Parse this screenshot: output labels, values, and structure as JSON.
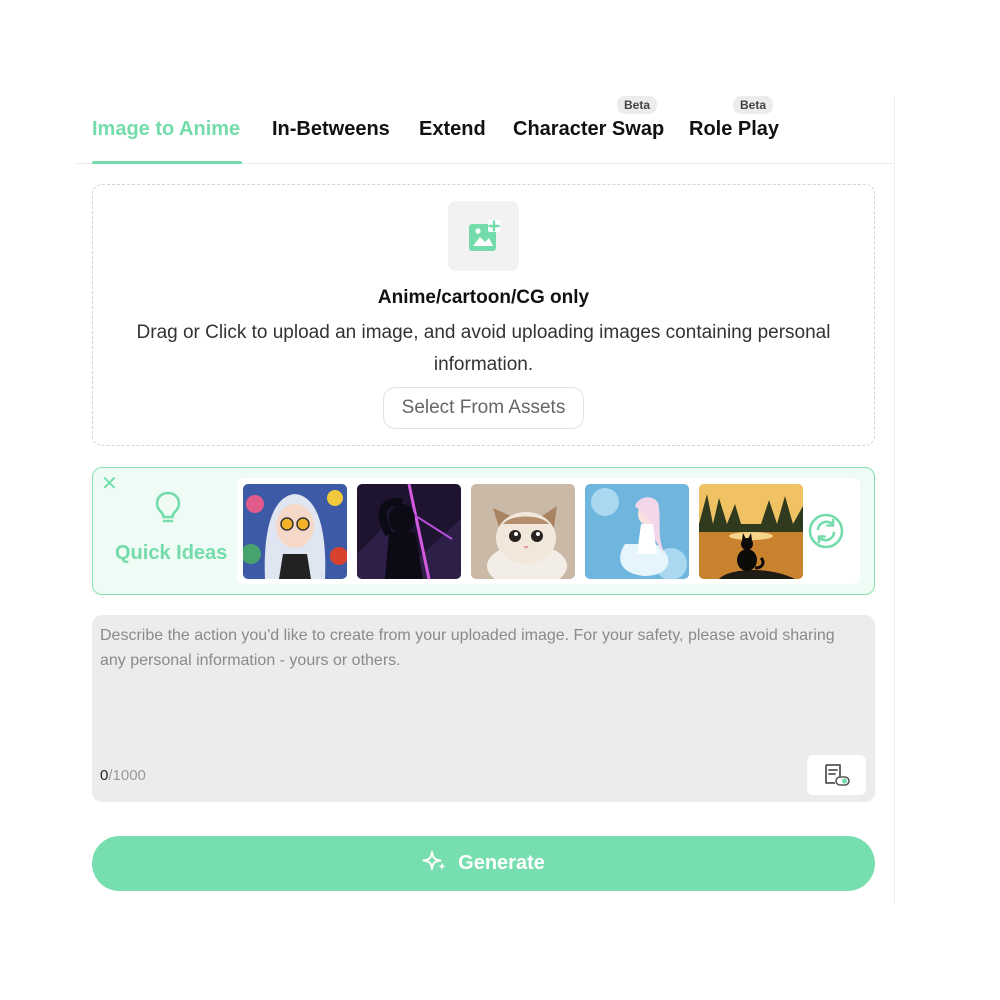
{
  "tabs": [
    {
      "label": "Image to Anime",
      "active": true
    },
    {
      "label": "In-Betweens",
      "active": false
    },
    {
      "label": "Extend",
      "active": false
    },
    {
      "label": "Character Swap",
      "active": false,
      "badge": "Beta"
    },
    {
      "label": "Role Play",
      "active": false,
      "badge": "Beta"
    }
  ],
  "upload": {
    "icon": "image-add-icon",
    "title": "Anime/cartoon/CG only",
    "description": "Drag or Click to upload an image, and avoid uploading images containing personal information.",
    "assets_button": "Select From Assets"
  },
  "quick_ideas": {
    "close_icon": "close-icon",
    "icon": "lightbulb-icon",
    "label": "Quick Ideas",
    "thumbnails": [
      "anime-girl-sunglasses-thumbnail",
      "dark-neon-warrior-thumbnail",
      "kitten-thumbnail",
      "ice-fairy-girl-thumbnail",
      "cat-silhouette-sunset-thumbnail"
    ],
    "refresh_icon": "refresh-icon"
  },
  "prompt": {
    "placeholder": "Describe the action you'd like to create from your uploaded image. For your safety, please avoid sharing any personal information - yours or others.",
    "value": "",
    "count_current": "0",
    "count_max": "/1000",
    "tool_icon": "prompt-template-icon"
  },
  "generate": {
    "icon": "sparkle-icon",
    "label": "Generate"
  },
  "colors": {
    "accent": "#74dcaa",
    "accent_bg": "#effbf5",
    "button": "#77deaf"
  }
}
